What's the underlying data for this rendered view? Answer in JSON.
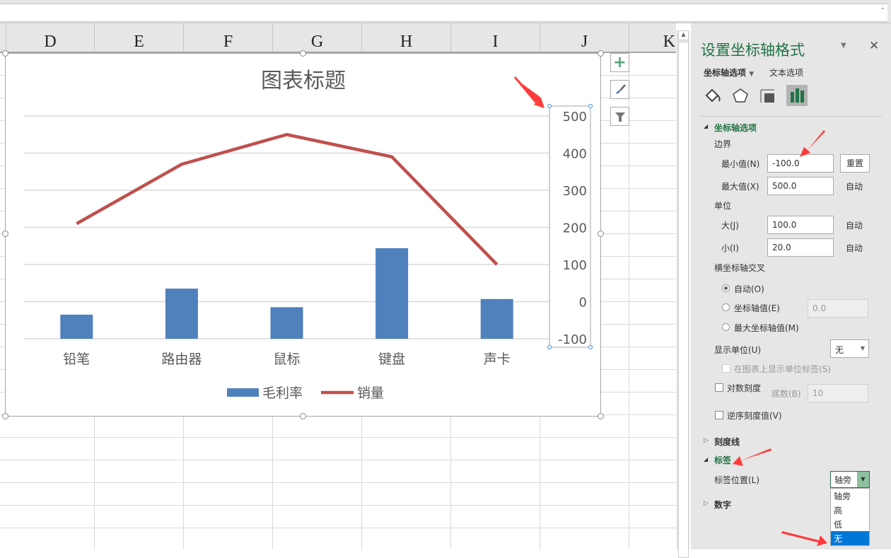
{
  "columns": [
    "D",
    "E",
    "F",
    "G",
    "H",
    "I",
    "J",
    "K"
  ],
  "chart": {
    "title": "图表标题",
    "legend": [
      {
        "name": "毛利率",
        "color": "#4f81bd"
      },
      {
        "name": "销量",
        "color": "#c0504d"
      }
    ]
  },
  "chart_data": {
    "type": "bar+line",
    "title": "图表标题",
    "categories": [
      "铅笔",
      "路由器",
      "鼠标",
      "键盘",
      "声卡"
    ],
    "series": [
      {
        "name": "毛利率",
        "type": "bar",
        "axis": "primary (hidden)",
        "values": [
          65,
          135,
          85,
          244,
          107
        ]
      },
      {
        "name": "销量",
        "type": "line",
        "axis": "secondary",
        "values": [
          210,
          370,
          450,
          390,
          100
        ]
      }
    ],
    "secondary_axis": {
      "ylim": [
        -100,
        500
      ],
      "ticks": [
        500,
        400,
        300,
        200,
        100,
        0,
        -100
      ],
      "position": "right"
    },
    "primary_axis": {
      "ylim": [
        0,
        600
      ],
      "visible": false
    },
    "grid": true,
    "legend": "bottom"
  },
  "chart_tools": [
    "add-element",
    "style",
    "filter"
  ],
  "panel": {
    "title": "设置坐标轴格式",
    "tab_axis": "坐标轴选项",
    "tab_text": "文本选项",
    "section_axis": "坐标轴选项",
    "bounds": "边界",
    "min_label": "最小值(N)",
    "min_value": "-100.0",
    "reset": "重置",
    "max_label": "最大值(X)",
    "max_value": "500.0",
    "auto": "自动",
    "units": "单位",
    "major_label": "大(J)",
    "major_value": "100.0",
    "minor_label": "小(I)",
    "minor_value": "20.0",
    "cross": "横坐标轴交叉",
    "cross_auto": "自动(O)",
    "cross_value": "坐标轴值(E)",
    "cross_value_input": "0.0",
    "cross_max": "最大坐标轴值(M)",
    "display_units": "显示单位(U)",
    "display_units_value": "无",
    "show_units_label": "在图表上显示单位标签(S)",
    "log_scale": "对数刻度",
    "base_label": "底数(B)",
    "base_value": "10",
    "reverse": "逆序刻度值(V)",
    "tick_marks": "刻度线",
    "labels": "标签",
    "label_position": "标签位置(L)",
    "label_position_value": "轴旁",
    "label_options": [
      "轴旁",
      "高",
      "低",
      "无"
    ],
    "selected_option": "无",
    "number": "数字"
  },
  "colors": {
    "accent": "#217346",
    "bar": "#4f81bd",
    "line": "#c0504d",
    "annotation": "#ff3b3b",
    "selected": "#0078d7"
  }
}
